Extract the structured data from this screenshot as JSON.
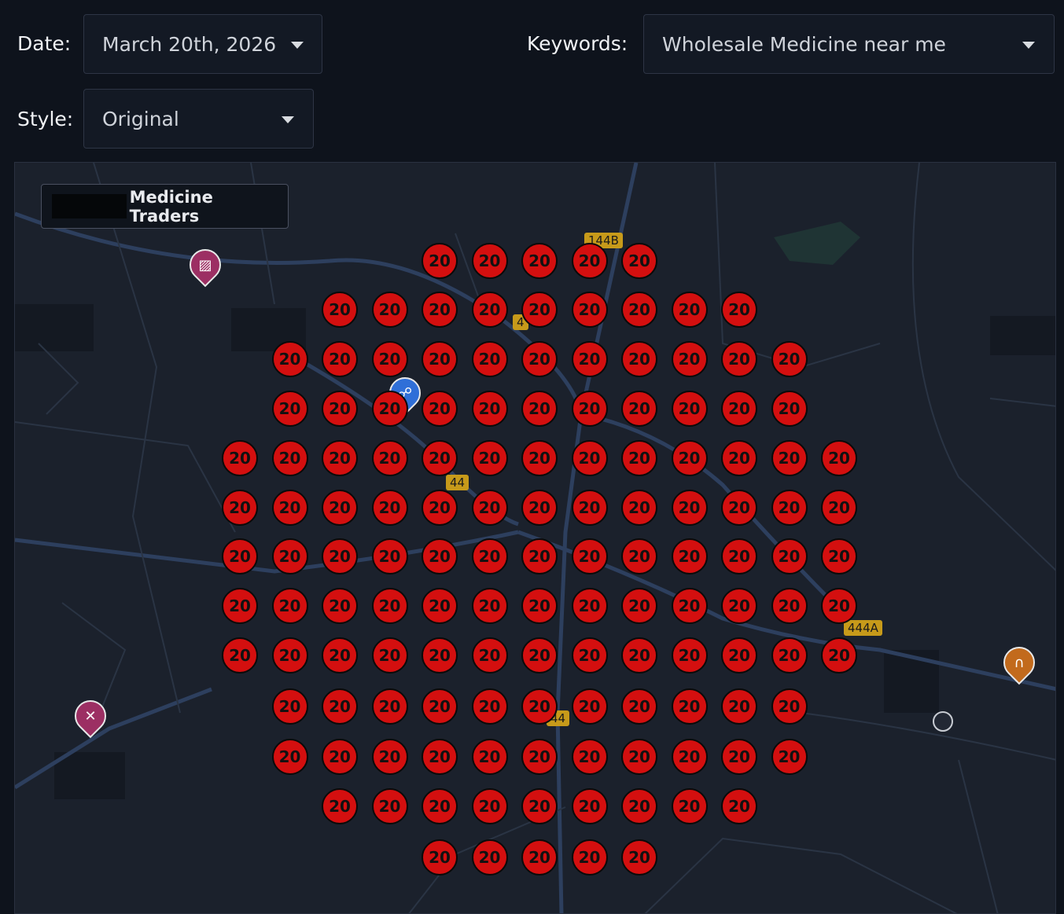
{
  "filters": {
    "date_label": "Date:",
    "date_value": "March 20th, 2026",
    "keywords_label": "Keywords:",
    "keywords_value": "Wholesale Medicine near me",
    "style_label": "Style:",
    "style_value": "Original"
  },
  "business": {
    "name": "Medicine Traders"
  },
  "road_labels": [
    "144B",
    "44",
    "444A",
    "44",
    "4"
  ],
  "grid": {
    "rank_value": "20",
    "rank_color": "#d40f0f",
    "row_counts": [
      5,
      9,
      11,
      11,
      13,
      13,
      13,
      13,
      13,
      11,
      11,
      9,
      5
    ]
  },
  "pois": [
    {
      "icon": "hotel-icon",
      "color": "#9c2f63"
    },
    {
      "icon": "shopping-cart-icon",
      "color": "#2f6fd8"
    },
    {
      "icon": "tools-icon",
      "color": "#9c2f63"
    },
    {
      "icon": "restaurant-icon",
      "color": "#c26a1c"
    },
    {
      "icon": "atm-icon",
      "color": "#1b212c"
    }
  ]
}
